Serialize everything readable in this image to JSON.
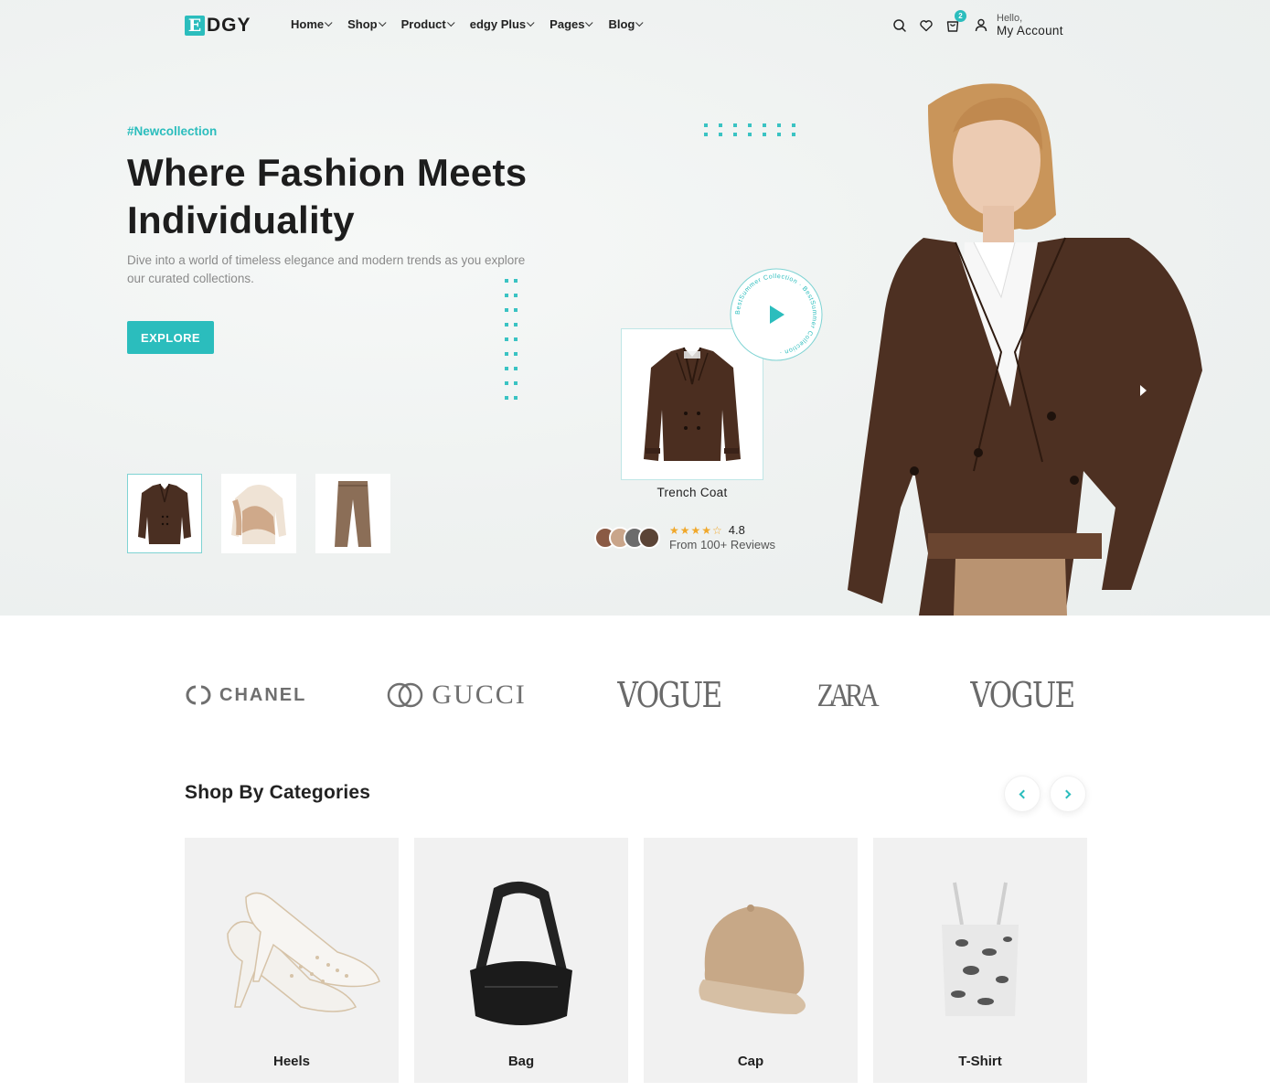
{
  "brand": {
    "logo_mark": "E",
    "logo_text": "DGY",
    "accent": "#2bbdbd"
  },
  "nav": [
    {
      "label": "Home"
    },
    {
      "label": "Shop"
    },
    {
      "label": "Product"
    },
    {
      "label": "edgy Plus"
    },
    {
      "label": "Pages"
    },
    {
      "label": "Blog"
    }
  ],
  "header": {
    "cart_count": "2",
    "account_greeting": "Hello,",
    "account_label": "My Account",
    "icons": [
      "search-icon",
      "heart-icon",
      "cart-icon",
      "user-icon"
    ]
  },
  "hero": {
    "tag": "#Newcollection",
    "headline": "Where Fashion Meets Individuality",
    "subtext": "Dive into a world of timeless elegance and modern trends as you explore our curated collections.",
    "cta": "EXPLORE",
    "thumbnails": [
      "Jacket",
      "Sweater",
      "Trousers"
    ],
    "featured_product": "Trench Coat",
    "badge_text": "BestSummer Collection · BestSummer Collection · ",
    "rating": "4.8",
    "stars": "★★★★☆",
    "review_count": "From 100+ Reviews"
  },
  "brands": [
    "CHANEL",
    "GUCCI",
    "VOGUE",
    "ZARA",
    "VOGUE"
  ],
  "categories": {
    "title": "Shop By Categories",
    "items": [
      {
        "label": "Heels"
      },
      {
        "label": "Bag"
      },
      {
        "label": "Cap"
      },
      {
        "label": "T-Shirt"
      }
    ]
  }
}
